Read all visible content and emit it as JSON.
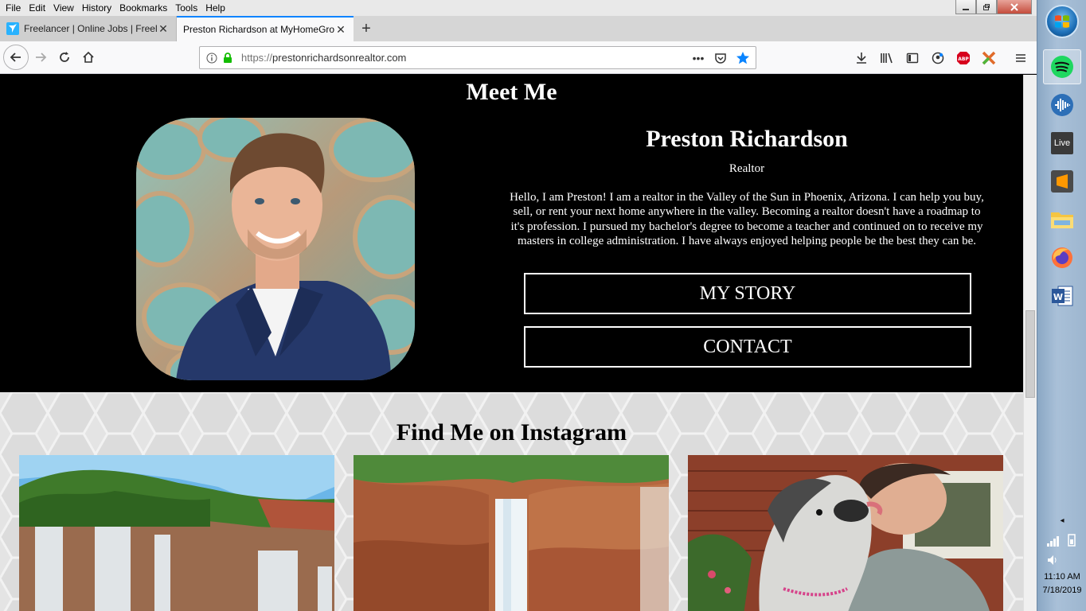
{
  "browser": {
    "menu": [
      "File",
      "Edit",
      "View",
      "History",
      "Bookmarks",
      "Tools",
      "Help"
    ],
    "tabs": [
      {
        "title": "Freelancer | Online Jobs | Freela",
        "favicon": "freelancer-bird-icon"
      },
      {
        "title": "Preston Richardson at MyHomeGro",
        "favicon": "none"
      }
    ],
    "new_tab_label": "+",
    "url": "https://prestonrichardsonrealtor.com",
    "url_scheme": "https://",
    "url_host": "prestonrichardsonrealtor.com",
    "accent_color": "#0a84ff"
  },
  "page": {
    "meet_heading": "Meet Me",
    "name": "Preston Richardson",
    "role": "Realtor",
    "bio": "Hello, I am Preston! I am a realtor in the Valley of the Sun in Phoenix, Arizona. I can help you buy, sell, or rent your next home anywhere in the valley. Becoming a realtor doesn't have a roadmap to it's profession. I pursued my bachelor's degree to become a teacher and continued on to receive my masters in college administration. I have always enjoyed helping people be the best they can be.",
    "story_button": "MY STORY",
    "contact_button": "CONTACT",
    "instagram_heading": "Find Me on Instagram"
  },
  "taskbar": {
    "apps": [
      "spotify-icon",
      "voice-app-icon",
      "live-icon",
      "sublime-text-icon",
      "file-explorer-icon",
      "firefox-icon",
      "word-icon"
    ],
    "live_label": "Live",
    "time": "11:10 AM",
    "date": "7/18/2019"
  }
}
